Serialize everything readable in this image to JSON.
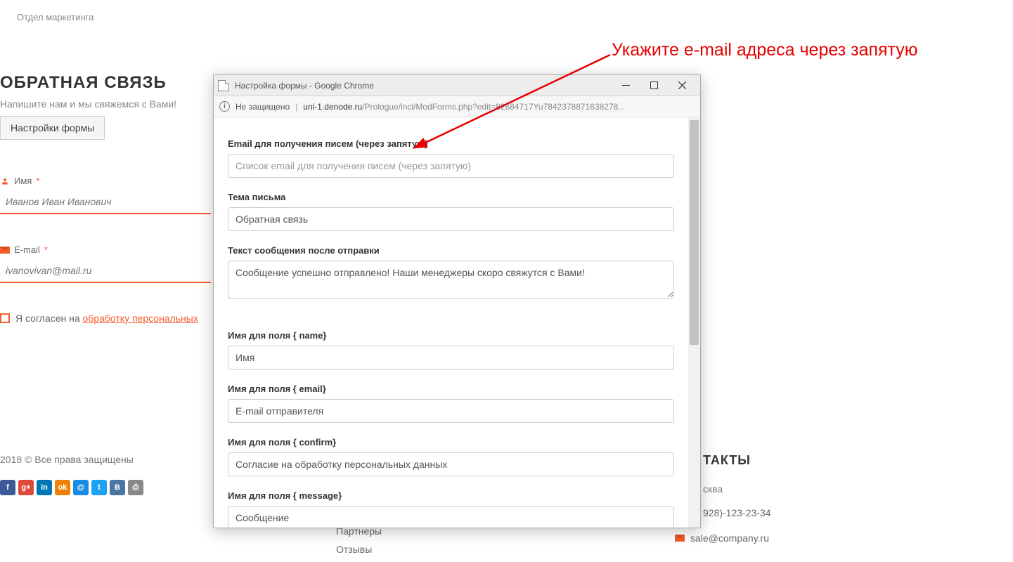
{
  "bg": {
    "dept": "Отдел маркетинга",
    "heading": "ОБРАТНАЯ СВЯЗЬ",
    "subtext": "Напишите нам и мы свяжемся с Вами!",
    "settings_btn": "Настройки формы",
    "name_label": "Имя",
    "name_placeholder": "Иванов Иван Иванович",
    "email_label": "E-mail",
    "email_placeholder": "ivanovivan@mail.ru",
    "consent_prefix": "Я согласен на ",
    "consent_link": "обработку персональных",
    "copyright": "2018 © Все права защищены",
    "contacts_title": "ТАКТЫ",
    "contacts_city": "сква",
    "contacts_phone": "928)-123-23-34",
    "contacts_mail": "sale@company.ru",
    "footer_partners": "Партнеры",
    "footer_reviews": "Отзывы"
  },
  "popup": {
    "title": "Настройка формы - Google Chrome",
    "addr_insecure": "Не защищено",
    "url_host": "uni-1.denode.ru",
    "url_path": "/Prologue/incl/ModForms.php?edit=82684717Yu7842378871638278...",
    "fields": {
      "email_label": "Email для получения писем (через запятую)",
      "email_placeholder": "Список email для получения писем (через запятую)",
      "subject_label": "Тема письма",
      "subject_value": "Обратная связь",
      "after_label": "Текст сообщения после отправки",
      "after_value": "Сообщение успешно отправлено! Наши менеджеры скоро свяжутся с Вами!",
      "name_field_label": "Имя для поля { name}",
      "name_field_value": "Имя",
      "email_field_label": "Имя для поля { email}",
      "email_field_value": "E-mail отправителя",
      "confirm_field_label": "Имя для поля { confirm}",
      "confirm_field_value": "Согласие на обработку персональных данных",
      "message_field_label": "Имя для поля { message}",
      "message_field_value": "Сообщение"
    }
  },
  "annotation": "Укажите e-mail адреса через запятую"
}
